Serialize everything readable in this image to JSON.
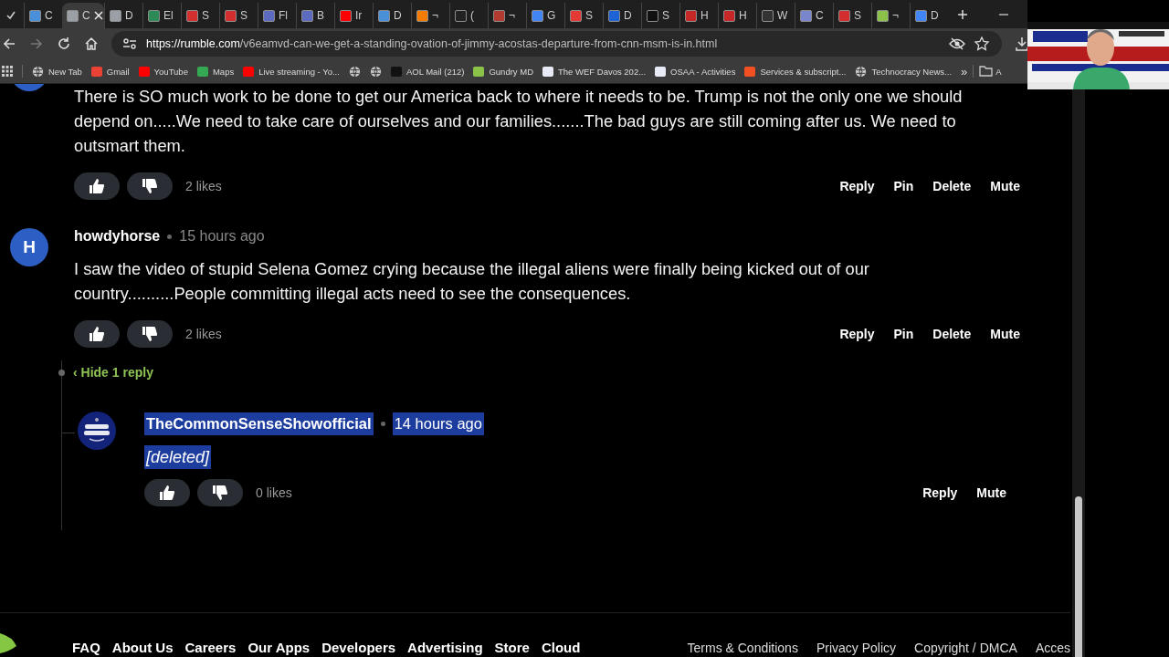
{
  "browser": {
    "tabs": [
      {
        "title": "C",
        "color": "#4a90d9",
        "selected": false
      },
      {
        "title": "C",
        "color": "#9aa0a6",
        "selected": true
      },
      {
        "title": "D",
        "color": "#9aa0a6",
        "selected": false
      },
      {
        "title": "El",
        "color": "#2e8b57",
        "selected": false
      },
      {
        "title": "S",
        "color": "#d32f2f",
        "selected": false
      },
      {
        "title": "S",
        "color": "#d32f2f",
        "selected": false
      },
      {
        "title": "Fl",
        "color": "#5c6bc0",
        "selected": false
      },
      {
        "title": "B",
        "color": "#5c6bc0",
        "selected": false
      },
      {
        "title": "Ir",
        "color": "#ff0000",
        "selected": false
      },
      {
        "title": "D",
        "color": "#4a90d9",
        "selected": false
      },
      {
        "title": "¬",
        "color": "#f57c00",
        "selected": false
      },
      {
        "title": "(",
        "color": "#222222",
        "selected": false
      },
      {
        "title": "¬",
        "color": "#b23a2e",
        "selected": false
      },
      {
        "title": "G",
        "color": "#4285f4",
        "selected": false
      },
      {
        "title": "S",
        "color": "#e53935",
        "selected": false
      },
      {
        "title": "D",
        "color": "#1e63d6",
        "selected": false
      },
      {
        "title": "S",
        "color": "#111111",
        "selected": false
      },
      {
        "title": "H",
        "color": "#c62828",
        "selected": false
      },
      {
        "title": "H",
        "color": "#c62828",
        "selected": false
      },
      {
        "title": "W",
        "color": "#333333",
        "selected": false
      },
      {
        "title": "C",
        "color": "#7986cb",
        "selected": false
      },
      {
        "title": "S",
        "color": "#d32f2f",
        "selected": false
      },
      {
        "title": "¬",
        "color": "#8bc34a",
        "selected": false
      },
      {
        "title": "D",
        "color": "#4285f4",
        "selected": false
      }
    ],
    "url_host": "https://rumble.com",
    "url_path": "/v6eamvd-can-we-get-a-standing-ovation-of-jimmy-acostas-departure-from-cnn-msm-is-in.html",
    "bookmarks": [
      {
        "kind": "globe",
        "label": "New Tab"
      },
      {
        "kind": "favicon",
        "label": "Gmail",
        "color": "#ea4335"
      },
      {
        "kind": "favicon",
        "label": "YouTube",
        "color": "#ff0000"
      },
      {
        "kind": "favicon",
        "label": "Maps",
        "color": "#34a853"
      },
      {
        "kind": "favicon",
        "label": "Live streaming - Yo...",
        "color": "#ff0000"
      },
      {
        "kind": "globe"
      },
      {
        "kind": "globe"
      },
      {
        "kind": "favicon",
        "label": "AOL Mail (212)",
        "color": "#111111"
      },
      {
        "kind": "favicon",
        "label": "Gundry MD",
        "color": "#8bc34a"
      },
      {
        "kind": "favicon",
        "label": "The WEF Davos 202...",
        "color": "#e8eaf6"
      },
      {
        "kind": "favicon",
        "label": "OSAA - Activities",
        "color": "#e8eaf6"
      },
      {
        "kind": "favicon",
        "label": "Services & subscript...",
        "color": "#f25022"
      },
      {
        "kind": "globe",
        "label": "Technocracy News..."
      }
    ],
    "overflow": "»",
    "folder_label": "A"
  },
  "comments": [
    {
      "avatar_visible": false,
      "text": "There is SO much work to be done to get our America back to where it needs to be. Trump is not the only one we should depend on.....We need to take care of ourselves and our families.......The bad guys are still coming after us. We need to outsmart them.",
      "likes": "2 likes",
      "actions": [
        "Reply",
        "Pin",
        "Delete",
        "Mute"
      ]
    },
    {
      "avatar_visible": true,
      "avatar_letter": "H",
      "author": "howdyhorse",
      "time": "15 hours ago",
      "text": "I saw the video of stupid Selena Gomez crying because the illegal aliens were finally being kicked out of our country..........People committing illegal acts need to see the consequences.",
      "likes": "2 likes",
      "actions": [
        "Reply",
        "Pin",
        "Delete",
        "Mute"
      ],
      "replies_toggle": "‹ Hide 1 reply",
      "replies": [
        {
          "author": "TheCommonSenseShowofficial",
          "time": "14 hours ago",
          "text": "[deleted]",
          "highlighted": true,
          "likes": "0 likes",
          "actions": [
            "Reply",
            "Mute"
          ]
        }
      ]
    }
  ],
  "footer": {
    "links": [
      "FAQ",
      "About Us",
      "Careers",
      "Our Apps",
      "Developers",
      "Advertising",
      "Store",
      "Cloud"
    ],
    "legal": [
      "Terms & Conditions",
      "Privacy Policy",
      "Copyright / DMCA",
      "Acces"
    ]
  }
}
